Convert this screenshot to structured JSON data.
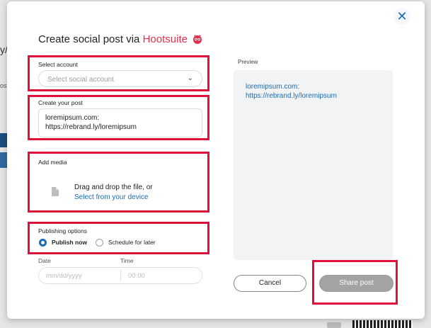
{
  "background": {
    "fragment_1": "y/",
    "fragment_2": "os"
  },
  "modal": {
    "title_prefix": "Create social post via ",
    "brand": "Hootsuite",
    "close_icon": "close-icon"
  },
  "select_account": {
    "label": "Select account",
    "placeholder": "Select social account",
    "chevron_icon": "chevron-down-icon"
  },
  "create_post": {
    "label": "Create your post",
    "value": "loremipsum.com:\nhttps://rebrand.ly/loremipsum"
  },
  "add_media": {
    "label": "Add media",
    "drop_text": "Drag and drop the file, or",
    "link_text": "Select from your device",
    "file_icon": "file-icon"
  },
  "publishing": {
    "label": "Publishing options",
    "options": [
      {
        "label": "Publish now",
        "selected": true
      },
      {
        "label": "Schedule for later",
        "selected": false
      }
    ]
  },
  "schedule": {
    "date_label": "Date",
    "time_label": "Time",
    "date_placeholder": "mm/dd/yyyy",
    "time_placeholder": "00:00"
  },
  "preview": {
    "label": "Preview",
    "text": "loremipsum.com:\nhttps://rebrand.ly/loremipsum"
  },
  "buttons": {
    "cancel": "Cancel",
    "share": "Share post"
  },
  "colors": {
    "accent": "#1a6cb5",
    "brand": "#e0304a",
    "highlight": "#e0103a",
    "share_disabled": "#a3a3a3"
  }
}
